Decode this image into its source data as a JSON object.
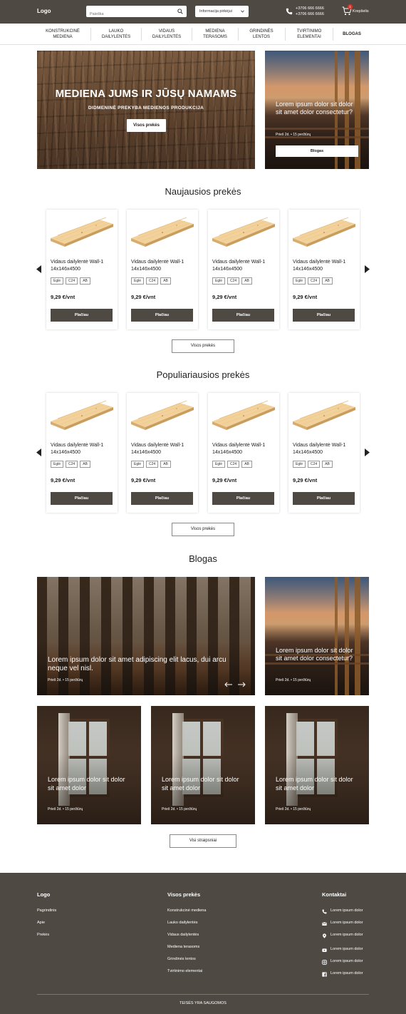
{
  "header": {
    "logo": "Logo",
    "search_placeholder": "Paieška",
    "info_select": "Informacija pirkėjui",
    "phones": [
      "+3706 666 6666",
      "+3706 666 6666"
    ],
    "cart_count": "1",
    "cart_label": "Krepšelis"
  },
  "nav": [
    {
      "line1": "KONSTRUKCINĖ",
      "line2": "MEDIENA"
    },
    {
      "line1": "LAUKO",
      "line2": "DAILYLENTĖS"
    },
    {
      "line1": "VIDAUS",
      "line2": "DAILYLENTĖS"
    },
    {
      "line1": "MEDIENA",
      "line2": "TERASOMS"
    },
    {
      "line1": "GRINDINĖS",
      "line2": "LENTOS"
    },
    {
      "line1": "TVIRTINIMO",
      "line2": "ELEMENTAI"
    },
    {
      "line1": "BLOGAS",
      "line2": ""
    }
  ],
  "hero": {
    "title": "MEDIENA JUMS IR JŪSŲ NAMAMS",
    "subtitle": "DIDMENINĖ PREKYBA MEDIENOS PRODUKCIJA",
    "button": "Visos prekės"
  },
  "hero_side": {
    "title": "Lorem ipsum dolor sit dolor sit amet dolor consectetur?",
    "meta": "Prieš 2d.  •  15 peržiūrų",
    "button": "Blogas"
  },
  "newest": {
    "title": "Naujausios prekės",
    "all_button": "Visos prekės",
    "products": [
      {
        "name": "Vidaus dailylentė Wall-1 14x146x4500",
        "tags": [
          "Eglė",
          "C24",
          "AB"
        ],
        "price": "9,29 €/vnt",
        "button": "Plačiau"
      },
      {
        "name": "Vidaus dailylentė Wall-1 14x146x4500",
        "tags": [
          "Eglė",
          "C24",
          "AB"
        ],
        "price": "9,29 €/vnt",
        "button": "Plačiau"
      },
      {
        "name": "Vidaus dailylentė Wall-1 14x146x4500",
        "tags": [
          "Eglė",
          "C24",
          "AB"
        ],
        "price": "9,29 €/vnt",
        "button": "Plačiau"
      },
      {
        "name": "Vidaus dailylentė Wall-1 14x146x4500",
        "tags": [
          "Eglė",
          "C24",
          "AB"
        ],
        "price": "9,29 €/vnt",
        "button": "Plačiau"
      }
    ]
  },
  "popular": {
    "title": "Populiariausios prekės",
    "all_button": "Visos prekės",
    "products": [
      {
        "name": "Vidaus dailylentė Wall-1 14x146x4500",
        "tags": [
          "Eglė",
          "C24",
          "AB"
        ],
        "price": "9,29 €/vnt",
        "button": "Plačiau"
      },
      {
        "name": "Vidaus dailylentė Wall-1 14x146x4500",
        "tags": [
          "Eglė",
          "C24",
          "AB"
        ],
        "price": "9,29 €/vnt",
        "button": "Plačiau"
      },
      {
        "name": "Vidaus dailylentė Wall-1 14x146x4500",
        "tags": [
          "Eglė",
          "C24",
          "AB"
        ],
        "price": "9,29 €/vnt",
        "button": "Plačiau"
      },
      {
        "name": "Vidaus dailylentė Wall-1 14x146x4500",
        "tags": [
          "Eglė",
          "C24",
          "AB"
        ],
        "price": "9,29 €/vnt",
        "button": "Plačiau"
      }
    ]
  },
  "blog": {
    "title": "Blogas",
    "all_button": "Visi straipsniai",
    "featured": {
      "title": "Lorem ipsum dolor sit amet adipiscing elit lacus, dui arcu neque vel nisl.",
      "meta": "Prieš 2d.  •  15 peržiūrų"
    },
    "side": {
      "title": "Lorem ipsum dolor sit dolor sit amet dolor consectetur?",
      "meta": "Prieš 2d.  •  15 peržiūrų"
    },
    "posts": [
      {
        "title": "Lorem ipsum dolor sit dolor sit amet dolor",
        "meta": "Prieš 2d.  •  15 peržiūrų"
      },
      {
        "title": "Lorem ipsum dolor sit dolor sit amet dolor",
        "meta": "Prieš 2d.  •  15 peržiūrų"
      },
      {
        "title": "Lorem ipsum dolor sit dolor sit amet dolor",
        "meta": "Prieš 2d.  •  15 peržiūrų"
      }
    ]
  },
  "footer": {
    "col1": {
      "title": "Logo",
      "links": [
        "Pagrindinis",
        "Apie",
        "Prekės"
      ]
    },
    "col2": {
      "title": "Visos prekės",
      "links": [
        "Konstrukcinė mediena",
        "Lauko dailylentės",
        "Vidaus dailylentės",
        "Mediena terasoms",
        "Grindinės lentos",
        "Tvirtinimo elementai"
      ]
    },
    "col3": {
      "title": "Kontaktai",
      "items": [
        {
          "icon": "phone-icon",
          "text": "Lorem ipsum dolor"
        },
        {
          "icon": "mail-icon",
          "text": "Lorem ipsum dolor"
        },
        {
          "icon": "location-icon",
          "text": "Lorem ipsum dolor"
        },
        {
          "icon": "youtube-icon",
          "text": "Lorem ipsum dolor"
        },
        {
          "icon": "instagram-icon",
          "text": "Lorem ipsum dolor"
        },
        {
          "icon": "facebook-icon",
          "text": "Lorem ipsum dolor"
        }
      ]
    },
    "copyright": "TEISĖS YRA SAUGOMOS"
  },
  "colors": {
    "brand_dark": "#4e4943",
    "badge": "#d9362b",
    "background": "#ffffff"
  }
}
